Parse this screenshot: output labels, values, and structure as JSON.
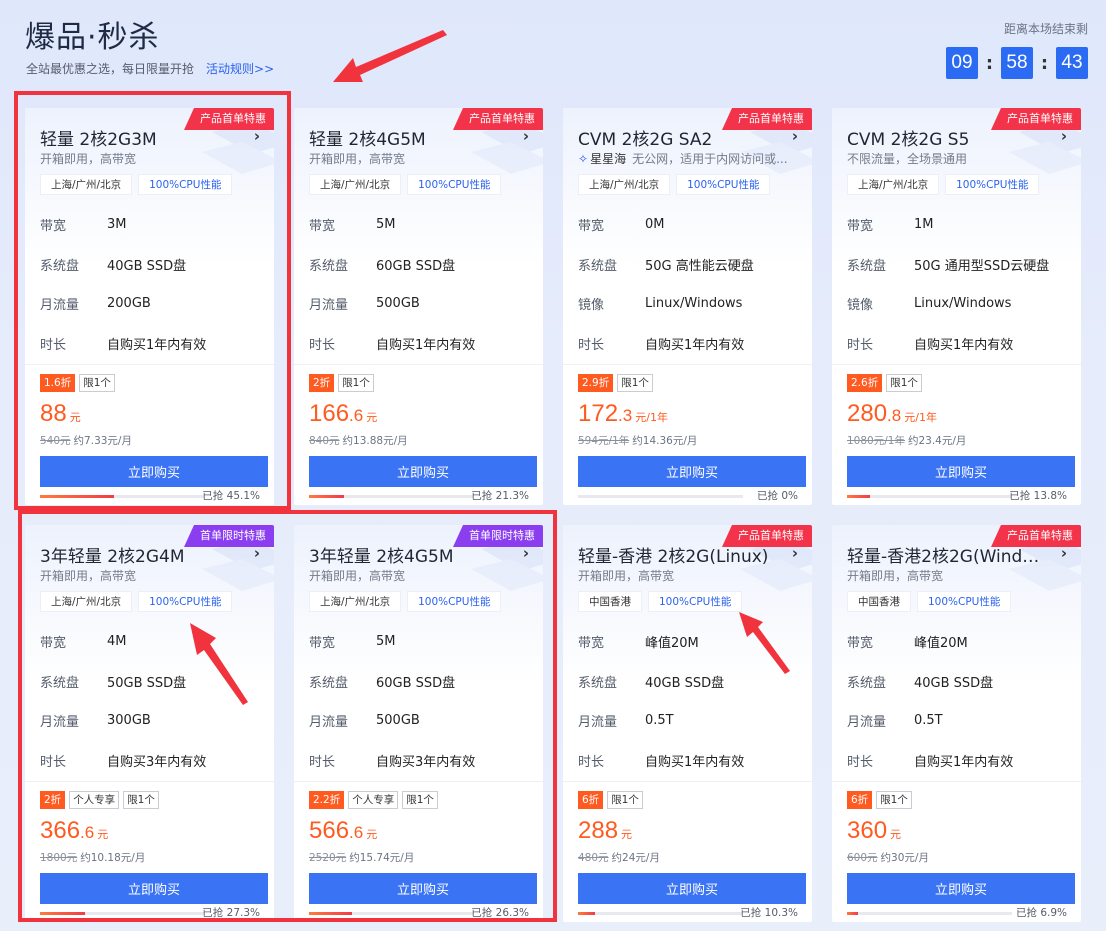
{
  "header": {
    "title": "爆品·秒杀",
    "subtitle": "全站最优惠之选，每日限量开抢",
    "rules_link": "活动规则>>",
    "countdown_label": "距离本场结束剩",
    "countdown": {
      "hours": "09",
      "minutes": "58",
      "seconds": "43",
      "sep": ":"
    }
  },
  "colors": {
    "accent": "#2b6bf3",
    "badge_red": "#f2334a",
    "badge_purple": "#8a3ef0",
    "price": "#ff5a1f"
  },
  "buy_label": "立即购买",
  "cards": [
    {
      "badge": "产品首单特惠",
      "badge_color": "red",
      "title": "轻量 2核2G3M",
      "subtitle": "开箱即用，高带宽",
      "brand": "",
      "tags": [
        "上海/广州/北京",
        "100%CPU性能"
      ],
      "specs": [
        {
          "label": "带宽",
          "value": "3M"
        },
        {
          "label": "系统盘",
          "value": "40GB SSD盘"
        },
        {
          "label": "月流量",
          "value": "200GB"
        },
        {
          "label": "时长",
          "value": "自购买1年内有效"
        }
      ],
      "labels": [
        "1.6折",
        "限1个"
      ],
      "price_int": "88",
      "price_dec": "",
      "price_unit": "元",
      "orig_price": "540元",
      "monthly": "约7.33元/月",
      "progress": 45.1,
      "progress_text": "已抢 45.1%"
    },
    {
      "badge": "产品首单特惠",
      "badge_color": "red",
      "title": "轻量 2核4G5M",
      "subtitle": "开箱即用，高带宽",
      "brand": "",
      "tags": [
        "上海/广州/北京",
        "100%CPU性能"
      ],
      "specs": [
        {
          "label": "带宽",
          "value": "5M"
        },
        {
          "label": "系统盘",
          "value": "60GB SSD盘"
        },
        {
          "label": "月流量",
          "value": "500GB"
        },
        {
          "label": "时长",
          "value": "自购买1年内有效"
        }
      ],
      "labels": [
        "2折",
        "限1个"
      ],
      "price_int": "166",
      "price_dec": ".6",
      "price_unit": "元",
      "orig_price": "840元",
      "monthly": "约13.88元/月",
      "progress": 21.3,
      "progress_text": "已抢 21.3%"
    },
    {
      "badge": "产品首单特惠",
      "badge_color": "red",
      "title": "CVM 2核2G SA2",
      "subtitle": "无公网，适用于内网访问或...",
      "brand": "星星海",
      "tags": [
        "上海/广州/北京",
        "100%CPU性能"
      ],
      "specs": [
        {
          "label": "带宽",
          "value": "0M"
        },
        {
          "label": "系统盘",
          "value": "50G 高性能云硬盘"
        },
        {
          "label": "镜像",
          "value": "Linux/Windows"
        },
        {
          "label": "时长",
          "value": "自购买1年内有效"
        }
      ],
      "labels": [
        "2.9折",
        "限1个"
      ],
      "price_int": "172",
      "price_dec": ".3",
      "price_unit": "元/1年",
      "orig_price": "594元/1年",
      "monthly": "约14.36元/月",
      "progress": 0,
      "progress_text": "已抢 0%"
    },
    {
      "badge": "产品首单特惠",
      "badge_color": "red",
      "title": "CVM 2核2G S5",
      "subtitle": "不限流量，全场景通用",
      "brand": "",
      "tags": [
        "上海/广州/北京",
        "100%CPU性能"
      ],
      "specs": [
        {
          "label": "带宽",
          "value": "1M"
        },
        {
          "label": "系统盘",
          "value": "50G 通用型SSD云硬盘"
        },
        {
          "label": "镜像",
          "value": "Linux/Windows"
        },
        {
          "label": "时长",
          "value": "自购买1年内有效"
        }
      ],
      "labels": [
        "2.6折",
        "限1个"
      ],
      "price_int": "280",
      "price_dec": ".8",
      "price_unit": "元/1年",
      "orig_price": "1080元/1年",
      "monthly": "约23.4元/月",
      "progress": 13.8,
      "progress_text": "已抢 13.8%"
    },
    {
      "badge": "首单限时特惠",
      "badge_color": "purple",
      "title": "3年轻量 2核2G4M",
      "subtitle": "开箱即用，高带宽",
      "brand": "",
      "tags": [
        "上海/广州/北京",
        "100%CPU性能"
      ],
      "specs": [
        {
          "label": "带宽",
          "value": "4M"
        },
        {
          "label": "系统盘",
          "value": "50GB SSD盘"
        },
        {
          "label": "月流量",
          "value": "300GB"
        },
        {
          "label": "时长",
          "value": "自购买3年内有效"
        }
      ],
      "labels": [
        "2折",
        "个人专享",
        "限1个"
      ],
      "price_int": "366",
      "price_dec": ".6",
      "price_unit": "元",
      "orig_price": "1800元",
      "monthly": "约10.18元/月",
      "progress": 27.3,
      "progress_text": "已抢 27.3%"
    },
    {
      "badge": "首单限时特惠",
      "badge_color": "purple",
      "title": "3年轻量 2核4G5M",
      "subtitle": "开箱即用，高带宽",
      "brand": "",
      "tags": [
        "上海/广州/北京",
        "100%CPU性能"
      ],
      "specs": [
        {
          "label": "带宽",
          "value": "5M"
        },
        {
          "label": "系统盘",
          "value": "60GB SSD盘"
        },
        {
          "label": "月流量",
          "value": "500GB"
        },
        {
          "label": "时长",
          "value": "自购买3年内有效"
        }
      ],
      "labels": [
        "2.2折",
        "个人专享",
        "限1个"
      ],
      "price_int": "566",
      "price_dec": ".6",
      "price_unit": "元",
      "orig_price": "2520元",
      "monthly": "约15.74元/月",
      "progress": 26.3,
      "progress_text": "已抢 26.3%"
    },
    {
      "badge": "产品首单特惠",
      "badge_color": "red",
      "title": "轻量-香港 2核2G(Linux)",
      "subtitle": "开箱即用，高带宽",
      "brand": "",
      "tags": [
        "中国香港",
        "100%CPU性能"
      ],
      "specs": [
        {
          "label": "带宽",
          "value": "峰值20M"
        },
        {
          "label": "系统盘",
          "value": "40GB SSD盘"
        },
        {
          "label": "月流量",
          "value": "0.5T"
        },
        {
          "label": "时长",
          "value": "自购买1年内有效"
        }
      ],
      "labels": [
        "6折",
        "限1个"
      ],
      "price_int": "288",
      "price_dec": "",
      "price_unit": "元",
      "orig_price": "480元",
      "monthly": "约24元/月",
      "progress": 10.3,
      "progress_text": "已抢 10.3%"
    },
    {
      "badge": "产品首单特惠",
      "badge_color": "red",
      "title": "轻量-香港2核2G(Windo...",
      "subtitle": "开箱即用，高带宽",
      "brand": "",
      "tags": [
        "中国香港",
        "100%CPU性能"
      ],
      "specs": [
        {
          "label": "带宽",
          "value": "峰值20M"
        },
        {
          "label": "系统盘",
          "value": "40GB SSD盘"
        },
        {
          "label": "月流量",
          "value": "0.5T"
        },
        {
          "label": "时长",
          "value": "自购买1年内有效"
        }
      ],
      "labels": [
        "6折",
        "限1个"
      ],
      "price_int": "360",
      "price_dec": "",
      "price_unit": "元",
      "orig_price": "600元",
      "monthly": "约30元/月",
      "progress": 6.9,
      "progress_text": "已抢 6.9%"
    }
  ]
}
